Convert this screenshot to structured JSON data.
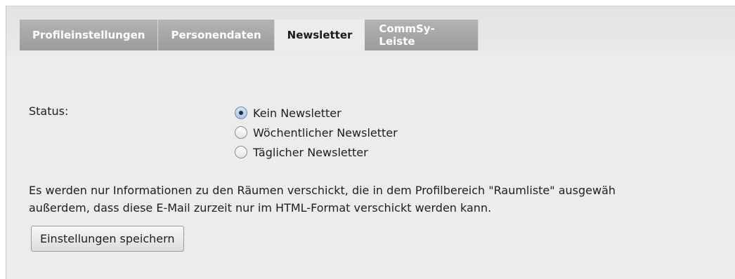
{
  "tabs": [
    {
      "label": "Profileinstellungen",
      "active": false
    },
    {
      "label": "Personendaten",
      "active": false
    },
    {
      "label": "Newsletter",
      "active": true
    },
    {
      "label": "CommSy-Leiste",
      "active": false
    }
  ],
  "form": {
    "status_label": "Status:",
    "options": [
      {
        "label": "Kein Newsletter",
        "selected": true
      },
      {
        "label": "Wöchentlicher Newsletter",
        "selected": false
      },
      {
        "label": "Täglicher Newsletter",
        "selected": false
      }
    ],
    "info_line1": "Es werden nur Informationen zu den Räumen verschickt, die in dem Profilbereich \"Raumliste\" ausgewäh",
    "info_line2": "außerdem, dass diese E-Mail zurzeit nur im HTML-Format verschickt werden kann.",
    "save_label": "Einstellungen speichern"
  },
  "colors": {
    "panel_bg": "#ececec",
    "tab_inactive_bg": "#a8a8a8",
    "radio_selected": "#a8c4e6"
  }
}
